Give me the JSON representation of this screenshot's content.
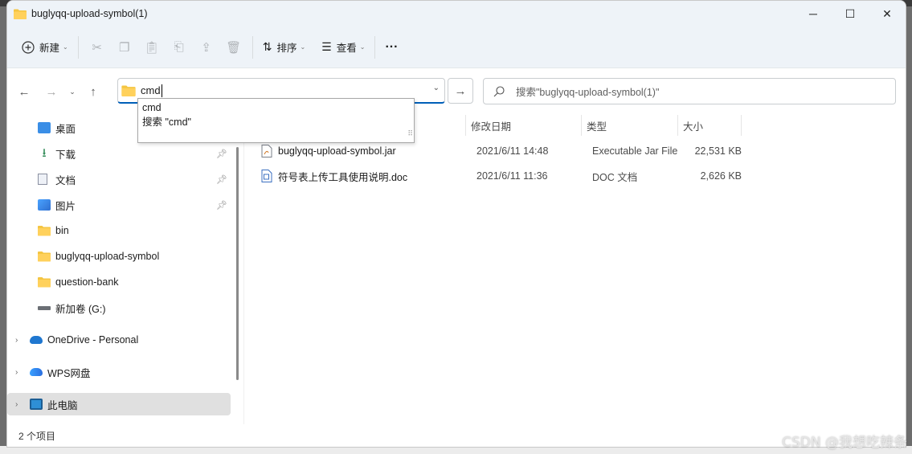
{
  "window": {
    "title": "buglyqq-upload-symbol(1)",
    "controls": {
      "minimize": "─",
      "maximize": "☐",
      "close": "✕"
    }
  },
  "toolbar": {
    "new_label": "新建",
    "sort_label": "排序",
    "view_label": "查看",
    "more_label": "···"
  },
  "nav": {
    "address_value": "cmd",
    "search_placeholder": "搜索\"buglyqq-upload-symbol(1)\""
  },
  "suggestions": [
    "cmd",
    "搜索 \"cmd\""
  ],
  "sidebar": {
    "quick_access": [
      {
        "label": "桌面",
        "icon": "desktop-icon",
        "pinned": false
      },
      {
        "label": "下载",
        "icon": "download-icon",
        "pinned": true
      },
      {
        "label": "文档",
        "icon": "document-icon",
        "pinned": true
      },
      {
        "label": "图片",
        "icon": "picture-icon",
        "pinned": true
      },
      {
        "label": "bin",
        "icon": "folder-icon",
        "pinned": false
      },
      {
        "label": "buglyqq-upload-symbol",
        "icon": "folder-icon",
        "pinned": false
      },
      {
        "label": "question-bank",
        "icon": "folder-icon",
        "pinned": false
      },
      {
        "label": "新加卷 (G:)",
        "icon": "drive-icon",
        "pinned": false
      }
    ],
    "roots": [
      {
        "label": "OneDrive - Personal",
        "icon": "cloud-icon"
      },
      {
        "label": "WPS网盘",
        "icon": "wps-cloud-icon"
      },
      {
        "label": "此电脑",
        "icon": "computer-icon",
        "selected": true
      }
    ]
  },
  "columns": {
    "date": "修改日期",
    "type": "类型",
    "size": "大小"
  },
  "files": [
    {
      "name": "buglyqq-upload-symbol.jar",
      "date": "2021/6/11 14:48",
      "type": "Executable Jar File",
      "size": "22,531 KB",
      "icon": "jar-file-icon"
    },
    {
      "name": "符号表上传工具使用说明.doc",
      "date": "2021/6/11 11:36",
      "type": "DOC 文档",
      "size": "2,626 KB",
      "icon": "doc-file-icon"
    }
  ],
  "status": {
    "item_count": "2 个项目"
  },
  "watermark": "CSDN @我想吃辣条",
  "colors": {
    "accent": "#005fb8",
    "titlebar": "#eef3f8",
    "folder": "#f4c542"
  }
}
